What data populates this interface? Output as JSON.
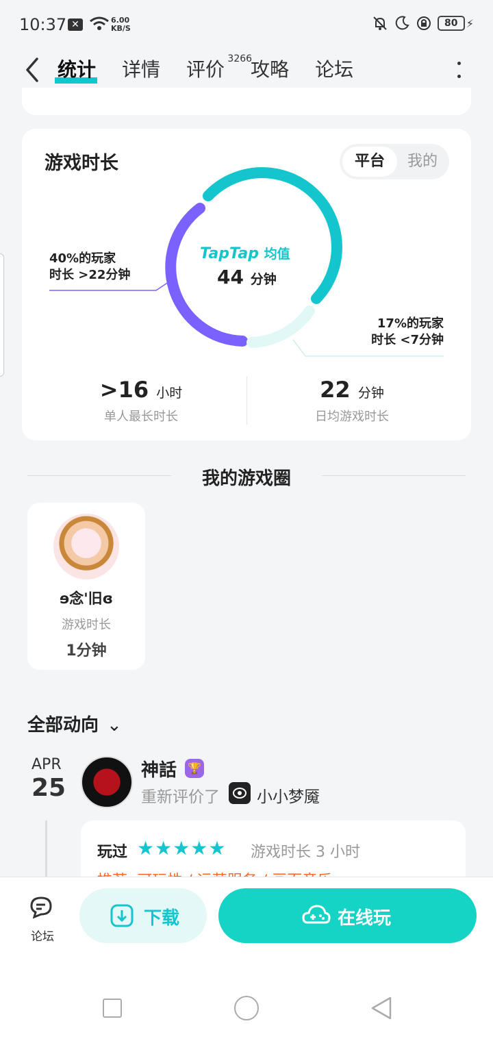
{
  "status_bar": {
    "time": "10:37",
    "speed_value": "6.00",
    "speed_unit": "KB/S",
    "battery": "80"
  },
  "header": {
    "tabs": [
      {
        "label": "统计"
      },
      {
        "label": "详情"
      },
      {
        "label": "评价",
        "badge": "3266"
      },
      {
        "label": "攻略"
      },
      {
        "label": "论坛"
      }
    ]
  },
  "stats_card": {
    "title": "游戏时长",
    "toggle": {
      "active": "平台",
      "inactive": "我的"
    },
    "donut": {
      "brand": "TapTap",
      "brand_suffix": "均值",
      "value": "44",
      "unit": "分钟"
    },
    "left_label": {
      "line1": "40%的玩家",
      "line2": "时长 >22分钟"
    },
    "right_label": {
      "line1": "17%的玩家",
      "line2": "时长 <7分钟"
    },
    "longest": {
      "value": ">16",
      "unit": "小时",
      "desc": "单人最长时长"
    },
    "daily": {
      "value": "22",
      "unit": "分钟",
      "desc": "日均游戏时长"
    },
    "colors": {
      "purple": "#7b61ff",
      "teal": "#15c5ce",
      "light_teal": "#e2f8f6"
    }
  },
  "circle": {
    "title": "我的游戏圈",
    "member": {
      "name": "ɘ念'旧ɞ",
      "label": "游戏时长",
      "value": "1分钟"
    }
  },
  "feed": {
    "title": "全部动向",
    "date_month": "APR",
    "date_day": "25",
    "user": "神話",
    "action": "重新评价了",
    "game": "小小梦魇",
    "review": {
      "played": "玩过",
      "stars": "★★★★★",
      "rating": 5,
      "duration": "游戏时长 3 小时",
      "tags": "推荐: 可玩性 / 运营服务 / 画面音乐"
    }
  },
  "bottom_bar": {
    "forum": "论坛",
    "download": "下载",
    "play_online": "在线玩"
  }
}
